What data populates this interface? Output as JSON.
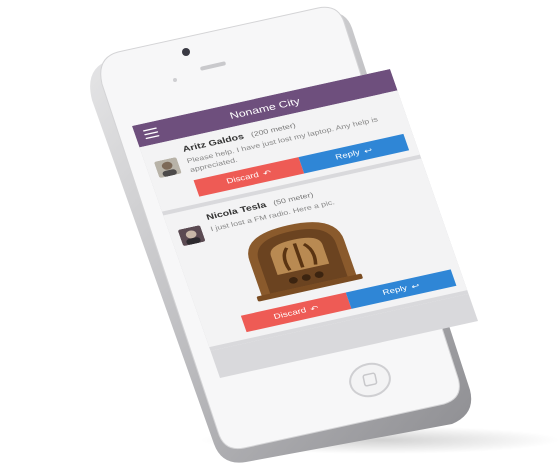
{
  "app": {
    "title": "Noname City"
  },
  "colors": {
    "topbar": "#6e4f7d",
    "discard": "#ee5b55",
    "reply": "#2f86d6"
  },
  "icons": {
    "menu": "hamburger-menu-icon",
    "reply": "reply-arrow-icon",
    "discard": "undo-arrow-icon"
  },
  "posts": [
    {
      "name": "Aritz Galdos",
      "distance": "(200 meter)",
      "message": "Please help. I have just lost my laptop. Any help is appreciated.",
      "discard_label": "Discard",
      "reply_label": "Reply"
    },
    {
      "name": "Nicola Tesla",
      "distance": "(50 meter)",
      "message": "I just lost a FM radio. Here a pic.",
      "discard_label": "Discard",
      "reply_label": "Reply"
    }
  ]
}
